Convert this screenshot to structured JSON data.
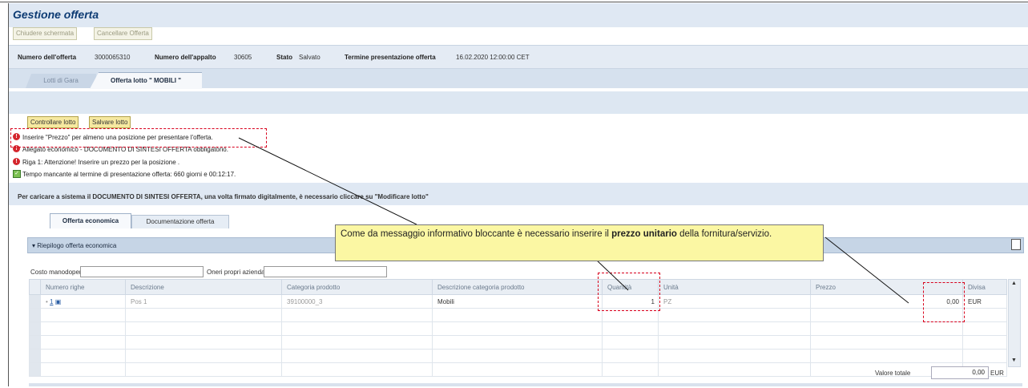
{
  "window": {
    "title": "Gestione offerta"
  },
  "toolbar": {
    "close_label": "Chiudere schermata",
    "cancel_label": "Cancellare Offerta"
  },
  "info": {
    "offer_label": "Numero dell'offerta",
    "offer_value": "3000065310",
    "tender_label": "Numero dell'appalto",
    "tender_value": "30605",
    "status_label": "Stato",
    "status_value": "Salvato",
    "deadline_label": "Termine presentazione offerta",
    "deadline_value": "16.02.2020 12:00:00 CET"
  },
  "tabs": {
    "lots": "Lotti di Gara",
    "offer_lot": "Offerta lotto \" MOBILI \""
  },
  "actions": {
    "check_lot": "Controllare lotto",
    "save_lot": "Salvare lotto"
  },
  "messages": [
    "Inserire \"Prezzo\" per almeno una posizione per presentare l'offerta.",
    "Allegato economico - DOCUMENTO DI SINTESI OFFERTA obbligatorio.",
    "Riga 1: Attenzione! Inserire un prezzo per la posizione .",
    "Tempo mancante al termine di presentazione offerta: 660  giorni e 00:12:17."
  ],
  "notice": "Per caricare a sistema il DOCUMENTO DI SINTESI OFFERTA, una volta firmato digitalmente, è necessario cliccare su \"Modificare lotto\"",
  "subtabs": {
    "economic": "Offerta economica",
    "docs": "Documentazione offerta"
  },
  "section": {
    "title": "Riepilogo offerta economica"
  },
  "fields": {
    "labor_label": "Costo manodopera:",
    "company_label": "Oneri propri aziendali:"
  },
  "table": {
    "headers": [
      "Numero righe",
      "Descrizione",
      "Categoria prodotto",
      "Descrizione categoria prodotto",
      "Quantità",
      "Unità",
      "Prezzo",
      "Divisa"
    ],
    "row": {
      "number": "1",
      "description": "Pos 1",
      "category": "39100000_3",
      "category_desc": "Mobili",
      "quantity": "1",
      "unit": "PZ",
      "price": "0,00",
      "currency": "EUR"
    }
  },
  "total": {
    "label": "Valore totale",
    "value": "0,00",
    "currency": "EUR"
  },
  "callout": {
    "text_before": "Come da messaggio informativo bloccante è necessario inserire il ",
    "text_bold": "prezzo unitario",
    "text_after": " della fornitura/servizio."
  },
  "colors": {
    "accent": "#0d3b73",
    "error": "#d4262d",
    "highlight": "#fbf7a3",
    "dash": "#d8001d"
  }
}
